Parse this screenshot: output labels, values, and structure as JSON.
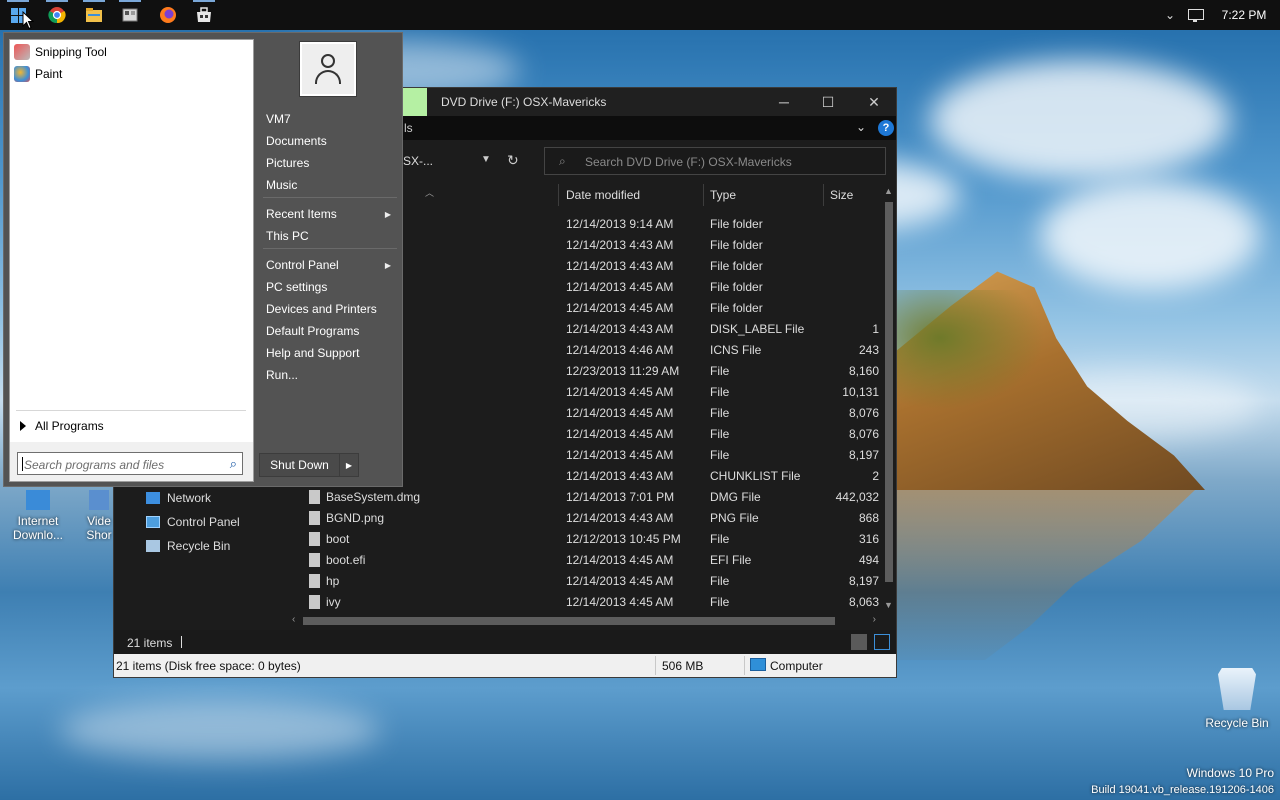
{
  "taskbar": {
    "icons": [
      "windows-start-icon",
      "chrome-icon",
      "file-explorer-icon",
      "app-icon",
      "firefox-icon",
      "store-icon"
    ],
    "clock": "7:22 PM",
    "tray_chevron": "⌄"
  },
  "start_menu": {
    "programs": [
      {
        "label": "Snipping Tool",
        "icon": "snipping-tool-icon",
        "color": "#d94f4f"
      },
      {
        "label": "Paint",
        "icon": "paint-icon",
        "color": "#f2b632"
      }
    ],
    "all_programs": "All Programs",
    "search_placeholder": "Search programs and files",
    "right_items": [
      {
        "label": "VM7",
        "submenu": false
      },
      {
        "label": "Documents",
        "submenu": false
      },
      {
        "label": "Pictures",
        "submenu": false
      },
      {
        "label": "Music",
        "submenu": false
      },
      {
        "label": "Recent Items",
        "submenu": true
      },
      {
        "label": "This PC",
        "submenu": false
      },
      {
        "label": "Control Panel",
        "submenu": true
      },
      {
        "label": "PC settings",
        "submenu": false
      },
      {
        "label": "Devices and Printers",
        "submenu": false
      },
      {
        "label": "Default Programs",
        "submenu": false
      },
      {
        "label": "Help and Support",
        "submenu": false
      },
      {
        "label": "Run...",
        "submenu": false
      }
    ],
    "submenu_glyph": "▶",
    "shutdown_label": "Shut Down"
  },
  "explorer": {
    "title": "DVD Drive (F:) OSX-Mavericks",
    "ribbon_partial": "ls",
    "address_partial": "SX-...",
    "search_placeholder": "Search DVD Drive (F:) OSX-Mavericks",
    "columns": {
      "date": "Date modified",
      "type": "Type",
      "size": "Size"
    },
    "rows": [
      {
        "name": "",
        "date": "12/14/2013 9:14 AM",
        "type": "File folder",
        "size": ""
      },
      {
        "name": "",
        "date": "12/14/2013 4:43 AM",
        "type": "File folder",
        "size": ""
      },
      {
        "name": "",
        "date": "12/14/2013 4:43 AM",
        "type": "File folder",
        "size": ""
      },
      {
        "name": "",
        "date": "12/14/2013 4:45 AM",
        "type": "File folder",
        "size": ""
      },
      {
        "name": "",
        "date": "12/14/2013 4:45 AM",
        "type": "File folder",
        "size": ""
      },
      {
        "name": "",
        "date": "12/14/2013 4:43 AM",
        "type": "DISK_LABEL File",
        "size": "1"
      },
      {
        "name": "ns",
        "date": "12/14/2013 4:46 AM",
        "type": "ICNS File",
        "size": "243"
      },
      {
        "name": "",
        "date": "12/23/2013 11:29 AM",
        "type": "File",
        "size": "8,160"
      },
      {
        "name": "",
        "date": "12/14/2013 4:45 AM",
        "type": "File",
        "size": "10,131"
      },
      {
        "name": "",
        "date": "12/14/2013 4:45 AM",
        "type": "File",
        "size": "8,076"
      },
      {
        "name": "",
        "date": "12/14/2013 4:45 AM",
        "type": "File",
        "size": "8,076"
      },
      {
        "name": "",
        "date": "12/14/2013 4:45 AM",
        "type": "File",
        "size": "8,197"
      },
      {
        "name": "unklist",
        "date": "12/14/2013 4:43 AM",
        "type": "CHUNKLIST File",
        "size": "2"
      },
      {
        "name": "BaseSystem.dmg",
        "date": "12/14/2013 7:01 PM",
        "type": "DMG File",
        "size": "442,032"
      },
      {
        "name": "BGND.png",
        "date": "12/14/2013 4:43 AM",
        "type": "PNG File",
        "size": "868"
      },
      {
        "name": "boot",
        "date": "12/12/2013 10:45 PM",
        "type": "File",
        "size": "316"
      },
      {
        "name": "boot.efi",
        "date": "12/14/2013 4:45 AM",
        "type": "EFI File",
        "size": "494"
      },
      {
        "name": "hp",
        "date": "12/14/2013 4:45 AM",
        "type": "File",
        "size": "8,197"
      },
      {
        "name": "ivy",
        "date": "12/14/2013 4:45 AM",
        "type": "File",
        "size": "8,063"
      }
    ],
    "nav": [
      {
        "label": "Network",
        "icon": "network-icon"
      },
      {
        "label": "Control Panel",
        "icon": "control-panel-icon"
      },
      {
        "label": "Recycle Bin",
        "icon": "recycle-bin-icon"
      }
    ],
    "status_items": "21 items",
    "details_status": "21 items (Disk free space: 0 bytes)",
    "details_size": "506 MB",
    "details_location": "Computer"
  },
  "desktop": {
    "icons": [
      {
        "label": "Internet Downlo...",
        "icon": "internet-download-manager-icon"
      },
      {
        "label": "Vide Shor",
        "icon": "video-shortcut-icon"
      }
    ],
    "recycle_bin": "Recycle Bin",
    "os_name": "Windows 10 Pro",
    "build": "Build 19041.vb_release.191206-1406"
  }
}
